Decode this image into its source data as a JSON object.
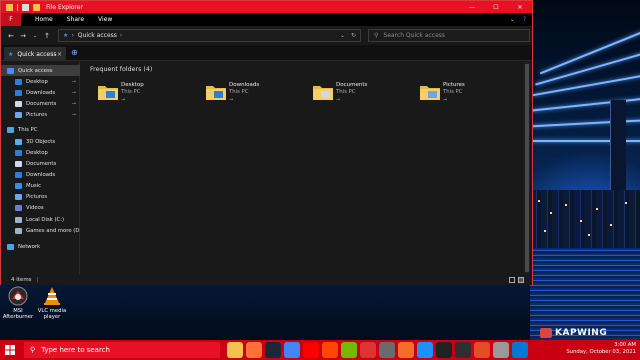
{
  "window": {
    "title": "File Explorer",
    "ribbon_tabs": [
      "Home",
      "Share",
      "View"
    ],
    "file_tab": "F",
    "controls": {
      "minimize": "—",
      "maximize": "☐",
      "close": "✕"
    }
  },
  "address": {
    "path": "Quick access",
    "search_placeholder": "Search Quick access"
  },
  "tabbar": {
    "tab_label": "Quick access",
    "close": "×",
    "new_tab": "⊕"
  },
  "sidebar": {
    "items": [
      {
        "label": "Quick access",
        "icon": "star-icon",
        "color": "#4a8cff",
        "pinned": false,
        "selected": true
      },
      {
        "label": "Desktop",
        "icon": "desktop-icon",
        "color": "#2d7fd6",
        "pinned": true
      },
      {
        "label": "Downloads",
        "icon": "download-icon",
        "color": "#2d7fd6",
        "pinned": true
      },
      {
        "label": "Documents",
        "icon": "documents-icon",
        "color": "#cfd8e6",
        "pinned": true
      },
      {
        "label": "Pictures",
        "icon": "pictures-icon",
        "color": "#6aa6e8",
        "pinned": true
      },
      {
        "label": "This PC",
        "icon": "computer-icon",
        "color": "#4fa3e0",
        "pinned": false
      },
      {
        "label": "3D Objects",
        "icon": "cube-icon",
        "color": "#4fb3e6",
        "pinned": false
      },
      {
        "label": "Desktop",
        "icon": "desktop-icon",
        "color": "#2d7fd6",
        "pinned": false
      },
      {
        "label": "Documents",
        "icon": "documents-icon",
        "color": "#cfd8e6",
        "pinned": false
      },
      {
        "label": "Downloads",
        "icon": "download-icon",
        "color": "#2d7fd6",
        "pinned": false
      },
      {
        "label": "Music",
        "icon": "music-icon",
        "color": "#3b8fe0",
        "pinned": false
      },
      {
        "label": "Pictures",
        "icon": "pictures-icon",
        "color": "#6aa6e8",
        "pinned": false
      },
      {
        "label": "Videos",
        "icon": "video-icon",
        "color": "#6a7fd0",
        "pinned": false
      },
      {
        "label": "Local Disk (C:)",
        "icon": "drive-icon",
        "color": "#9fb3c8",
        "pinned": false
      },
      {
        "label": "Games and more (D:)",
        "icon": "drive-icon",
        "color": "#9fb3c8",
        "pinned": false
      },
      {
        "label": "Network",
        "icon": "network-icon",
        "color": "#4fa3e0",
        "pinned": false
      }
    ],
    "pin_glyph": "📌"
  },
  "main": {
    "section_title": "Frequent folders (4)",
    "folders": [
      {
        "name": "Desktop",
        "location": "This PC",
        "icon": "desktop-folder-icon",
        "color": "#2d7fd6"
      },
      {
        "name": "Downloads",
        "location": "This PC",
        "icon": "downloads-folder-icon",
        "color": "#2d7fd6"
      },
      {
        "name": "Documents",
        "location": "This PC",
        "icon": "documents-folder-icon",
        "color": "#cfd8e6"
      },
      {
        "name": "Pictures",
        "location": "This PC",
        "icon": "pictures-folder-icon",
        "color": "#6aa6e8"
      }
    ]
  },
  "status": {
    "items_count": "4 items",
    "separator": "|"
  },
  "desktop_icons": [
    {
      "label_1": "MSI",
      "label_2": "Afterburner",
      "icon": "msi-afterburner-icon"
    },
    {
      "label_1": "VLC media",
      "label_2": "player",
      "icon": "vlc-icon"
    }
  ],
  "taskbar": {
    "search_placeholder": "Type here to search",
    "apps": [
      "file-explorer-icon",
      "firefox-icon",
      "steam-icon",
      "chrome-icon",
      "youtube-icon",
      "reddit-icon",
      "nvidia-icon",
      "game-icon",
      "gamepad-icon",
      "origin-icon",
      "uplay-icon",
      "notion-icon",
      "obs-icon",
      "paint-icon",
      "settings-icon",
      "mail-icon"
    ],
    "date": "Sunday, October 03, 2021",
    "time": "3:00 AM"
  },
  "watermark": "KAPWING",
  "colors": {
    "accent": "#e81123",
    "taskbar": "#c80012",
    "window_bg": "#191919"
  }
}
